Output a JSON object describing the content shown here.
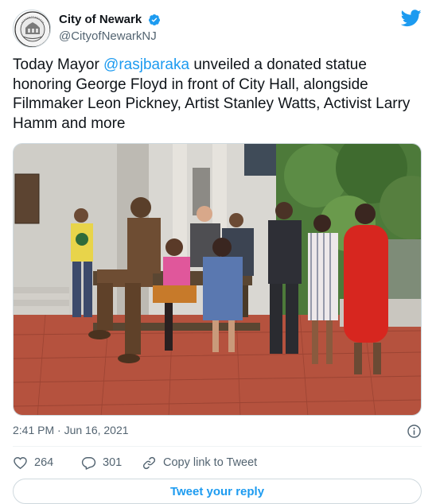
{
  "account": {
    "display_name": "City of Newark",
    "handle": "@CityofNewarkNJ",
    "seal_text": "CITY OF NEWARK"
  },
  "tweet": {
    "text_before": "Today Mayor ",
    "mention": "@rasjbaraka",
    "text_after": " unveiled a donated statue honoring George Floyd in front of City Hall, alongside Filmmaker Leon Pickney, Artist Stanley Watts, Activist Larry Hamm and more"
  },
  "meta": {
    "timestamp": "2:41 PM · Jun 16, 2021"
  },
  "actions": {
    "likes": "264",
    "replies": "301",
    "copy_link": "Copy link to Tweet"
  },
  "reply_button": "Tweet your reply",
  "colors": {
    "accent": "#1d9bf0",
    "secondary_text": "#536471",
    "brick": "#b5523e",
    "red_dress": "#d7261f"
  },
  "icons": [
    "verified-badge-icon",
    "twitter-bird-icon",
    "info-icon",
    "heart-icon",
    "reply-icon",
    "link-icon"
  ]
}
